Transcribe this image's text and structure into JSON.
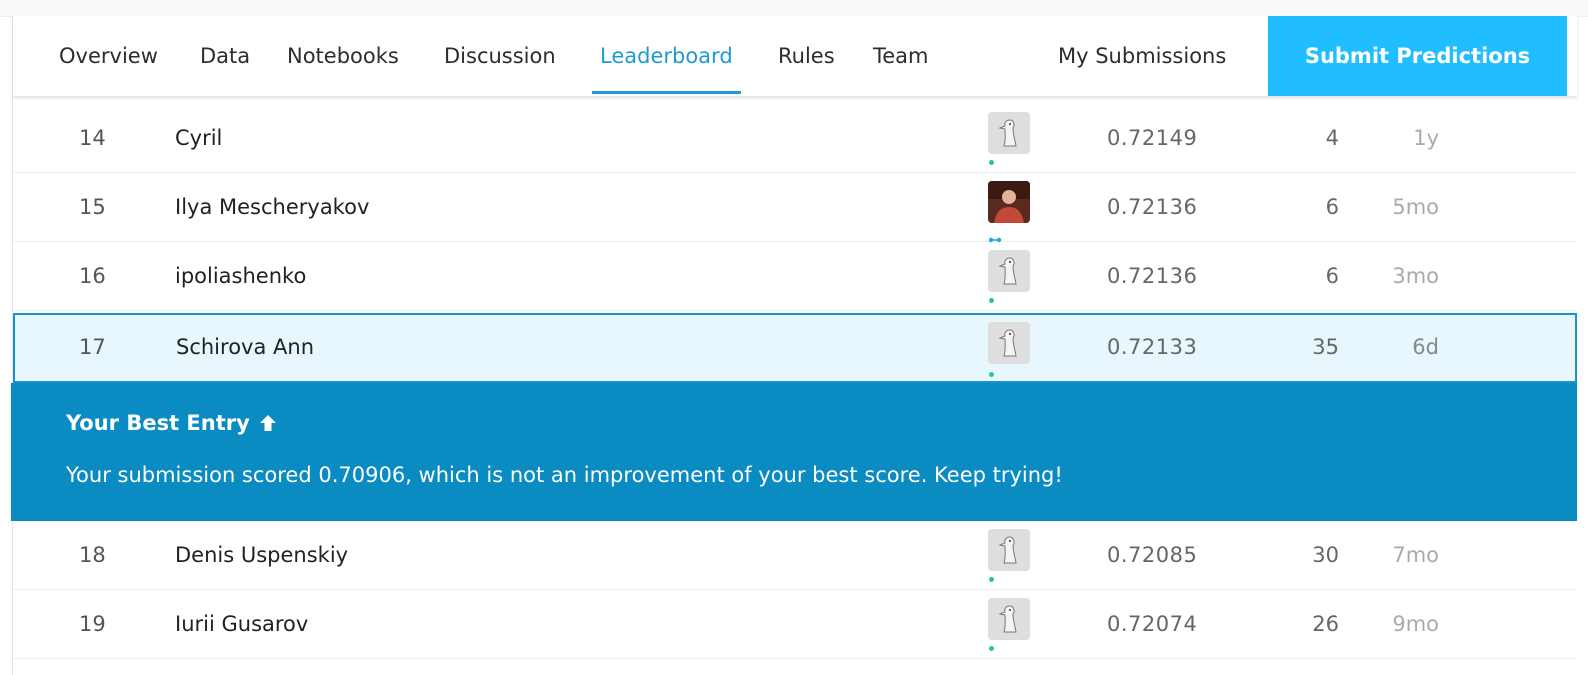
{
  "nav": {
    "tabs": [
      {
        "label": "Overview"
      },
      {
        "label": "Data"
      },
      {
        "label": "Notebooks"
      },
      {
        "label": "Discussion"
      },
      {
        "label": "Leaderboard",
        "active": true
      },
      {
        "label": "Rules"
      },
      {
        "label": "Team"
      }
    ],
    "my_submissions": "My Submissions",
    "submit_button": "Submit Predictions"
  },
  "leaderboard": {
    "rows_above": [
      {
        "rank": "14",
        "name": "Cyril",
        "avatar": "default-goose-avatar",
        "score": "0.72149",
        "entries": "4",
        "last": "1y"
      },
      {
        "rank": "15",
        "name": "Ilya Mescheryakov",
        "avatar": "user-photo-avatar",
        "score": "0.72136",
        "entries": "6",
        "last": "5mo"
      },
      {
        "rank": "16",
        "name": "ipoliashenko",
        "avatar": "default-goose-avatar",
        "score": "0.72136",
        "entries": "6",
        "last": "3mo"
      }
    ],
    "highlight_row": {
      "rank": "17",
      "name": "Schirova Ann",
      "avatar": "default-goose-avatar",
      "score": "0.72133",
      "entries": "35",
      "last": "6d"
    },
    "rows_below": [
      {
        "rank": "18",
        "name": "Denis Uspenskiy",
        "avatar": "default-goose-avatar",
        "score": "0.72085",
        "entries": "30",
        "last": "7mo"
      },
      {
        "rank": "19",
        "name": "Iurii Gusarov",
        "avatar": "default-goose-avatar",
        "score": "0.72074",
        "entries": "26",
        "last": "9mo"
      }
    ]
  },
  "banner": {
    "title": "Your Best Entry",
    "title_icon": "arrow-up-icon",
    "message": "Your submission scored 0.70906, which is not an improvement of your best score. Keep trying!"
  },
  "colors": {
    "accent": "#1f9bd1",
    "submit_bg": "#20beff",
    "banner_bg": "#0a8bc2",
    "highlight_bg": "#e8f7fd",
    "status_green": "#20c997"
  }
}
